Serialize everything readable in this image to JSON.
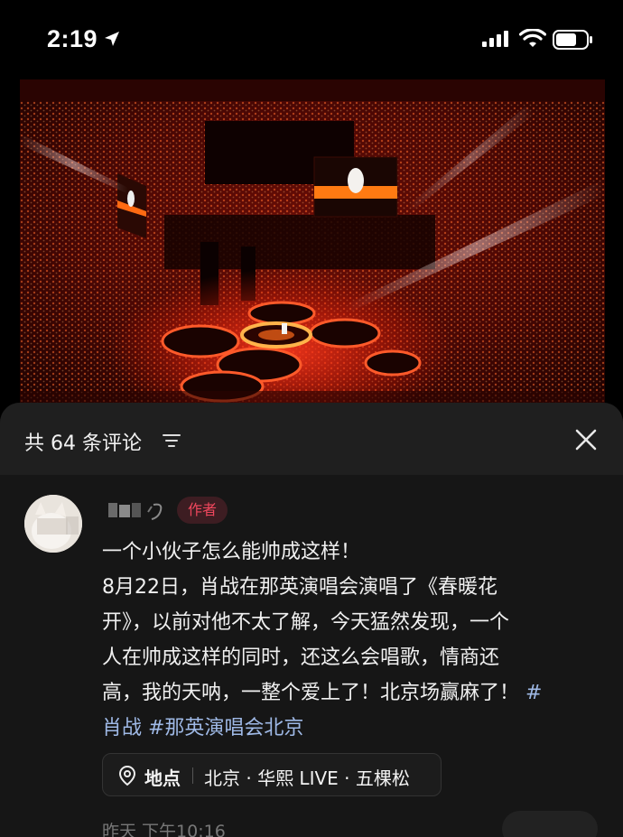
{
  "status_bar": {
    "time": "2:19",
    "icons": [
      "location-arrow-icon",
      "cellular-signal-icon",
      "wifi-icon",
      "battery-icon"
    ]
  },
  "media": {
    "description_icon": "concert-photo"
  },
  "comments": {
    "header": "共 64 条评论",
    "filter_icon": "filter-lines-icon",
    "close_icon": "close-icon",
    "items": [
      {
        "author_badge": "作者",
        "lines": [
          "一个小伙子怎么能帅成这样！",
          "8月22日，肖战在那英演唱会演唱了《春暖花",
          "开》，以前对他不太了解，今天猛然发现，一个",
          "人在帅成这样的同时，还这么会唱歌，情商还",
          "高，我的天呐，一整个爱上了！北京场赢麻了！"
        ],
        "hashtag_trail": "#",
        "last_line_plain": "肖战 ",
        "last_line_tag": "#那英演唱会北京",
        "location_label": "地点",
        "location_value": "北京 · 华熙 LIVE · 五棵松",
        "timestamp": "昨天  下午10:16"
      }
    ]
  },
  "colors": {
    "accent_red": "#f0475d",
    "hashtag_blue": "#9fb9e6",
    "sheet_bg": "#161616"
  }
}
